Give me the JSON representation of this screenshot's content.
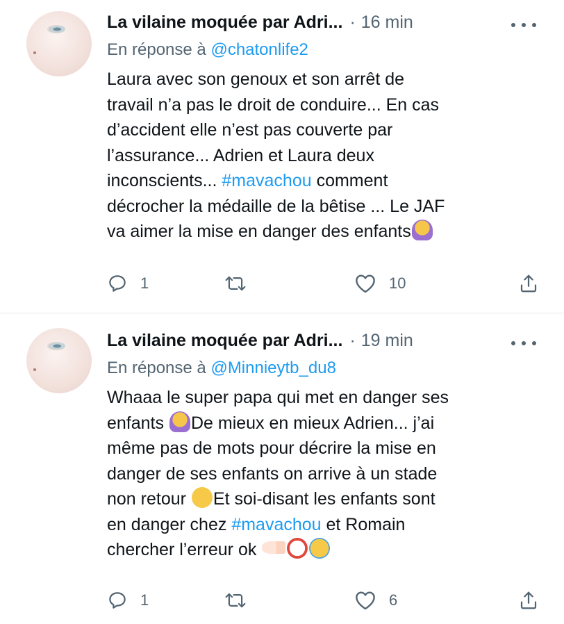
{
  "tweets": [
    {
      "author": "La vilaine moquée par Adri...",
      "separator": "·",
      "time": "16 min",
      "reply_prefix": "En réponse à",
      "reply_handle": "@chatonlife2",
      "text_lines": [
        "Laura avec son genoux et son arrêt de",
        "travail n’a pas le droit de conduire... En cas",
        "d’accident elle n’est pas couverte par",
        "l’assurance... Adrien et Laura deux",
        "inconscients...",
        "#mavachou",
        "comment",
        "décrocher la médaille de la bêtise ... Le JAF",
        "va aimer la mise en danger des enfants"
      ],
      "reply_count": "1",
      "retweet_count": "",
      "like_count": "10"
    },
    {
      "author": "La vilaine moquée par Adri...",
      "separator": "·",
      "time": "19 min",
      "reply_prefix": "En réponse à",
      "reply_handle": "@Minnieytb_du8",
      "text_lines": [
        "Whaaa le super papa qui met en danger ses",
        "enfants",
        "De mieux en mieux Adrien... j’ai",
        "même pas de mots pour décrire la mise en",
        "danger de ses enfants on arrive à un stade",
        "non retour",
        "Et soi-disant les enfants sont",
        "en danger chez",
        "#mavachou",
        "et Romain",
        "chercher l’erreur ok"
      ],
      "reply_count": "1",
      "retweet_count": "",
      "like_count": "6"
    }
  ],
  "icons": {
    "reply": "reply-icon",
    "retweet": "retweet-icon",
    "like": "heart-icon",
    "share": "share-icon",
    "more": "more-icon"
  },
  "colors": {
    "link": "#1d9bf0",
    "secondary": "#536471",
    "text": "#0f1419",
    "divider": "#e1e8ed"
  }
}
